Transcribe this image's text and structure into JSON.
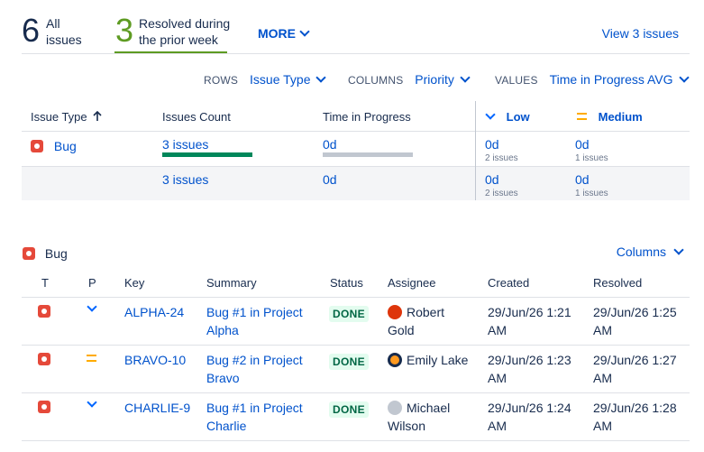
{
  "stats": {
    "all": {
      "number": "6",
      "label_line1": "All",
      "label_line2": "issues"
    },
    "resolved": {
      "number": "3",
      "label_line1": "Resolved during",
      "label_line2": "the prior week"
    },
    "more_label": "MORE",
    "view_link": "View 3 issues"
  },
  "controls": {
    "rows_label": "ROWS",
    "rows_value": "Issue Type",
    "columns_label": "COLUMNS",
    "columns_value": "Priority",
    "values_label": "VALUES",
    "values_value": "Time in Progress AVG"
  },
  "pivot": {
    "headers": {
      "issue_type": "Issue Type",
      "issues_count": "Issues Count",
      "time_in_progress": "Time in Progress",
      "low": "Low",
      "medium": "Medium"
    },
    "bug_row": {
      "type": "Bug",
      "count": "3 issues",
      "time": "0d",
      "low_value": "0d",
      "low_sub": "2 issues",
      "medium_value": "0d",
      "medium_sub": "1 issues"
    },
    "total_row": {
      "count": "3 issues",
      "time": "0d",
      "low_value": "0d",
      "low_sub": "2 issues",
      "medium_value": "0d",
      "medium_sub": "1 issues"
    },
    "bar_fill": {
      "issues_count": 1.0,
      "time_in_progress": 0.0
    }
  },
  "detail": {
    "title": "Bug",
    "columns_button": "Columns",
    "headers": {
      "t": "T",
      "p": "P",
      "key": "Key",
      "summary": "Summary",
      "status": "Status",
      "assignee": "Assignee",
      "created": "Created",
      "resolved": "Resolved"
    },
    "rows": [
      {
        "priority": "low",
        "key": "ALPHA-24",
        "summary_1": "Bug #1 in Project",
        "summary_2": "Alpha",
        "status": "DONE",
        "assignee_1": "Robert",
        "assignee_2": "Gold",
        "created_1": "29/Jun/26 1:21",
        "created_2": "AM",
        "resolved_1": "29/Jun/26 1:25",
        "resolved_2": "AM"
      },
      {
        "priority": "medium",
        "key": "BRAVO-10",
        "summary_1": "Bug #2 in Project",
        "summary_2": "Bravo",
        "status": "DONE",
        "assignee_1": "Emily Lake",
        "assignee_2": "",
        "created_1": "29/Jun/26 1:23",
        "created_2": "AM",
        "resolved_1": "29/Jun/26 1:27",
        "resolved_2": "AM"
      },
      {
        "priority": "low",
        "key": "CHARLIE-9",
        "summary_1": "Bug #1 in Project",
        "summary_2": "Charlie",
        "status": "DONE",
        "assignee_1": "Michael",
        "assignee_2": "Wilson",
        "created_1": "29/Jun/26 1:24",
        "created_2": "AM",
        "resolved_1": "29/Jun/26 1:28",
        "resolved_2": "AM"
      }
    ]
  }
}
